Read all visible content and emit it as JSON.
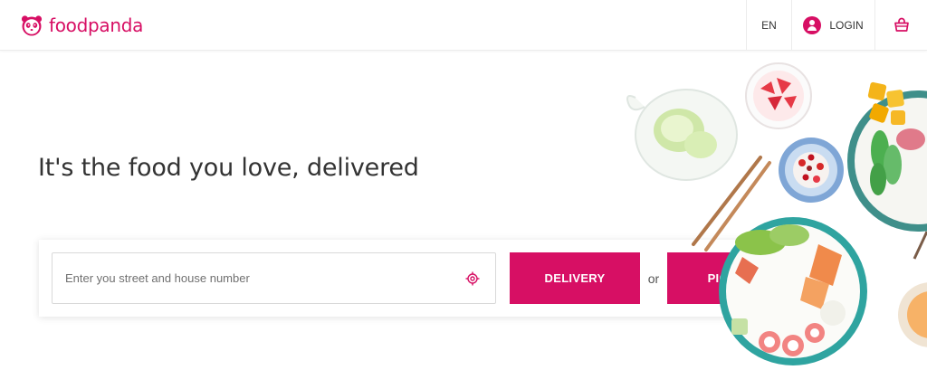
{
  "header": {
    "brand": "foodpanda",
    "language": "EN",
    "login_label": "LOGIN"
  },
  "hero": {
    "headline": "It's the food you love, delivered",
    "address_placeholder": "Enter you street and house number",
    "delivery_label": "DELIVERY",
    "or_label": "or",
    "pickup_label": "PICK UP"
  },
  "icons": {
    "logo": "panda-logo-icon",
    "account": "user-icon",
    "cart": "basket-icon",
    "locate": "crosshair-icon"
  },
  "colors": {
    "brand": "#d70f64",
    "text": "#333333",
    "border": "#ececec"
  }
}
